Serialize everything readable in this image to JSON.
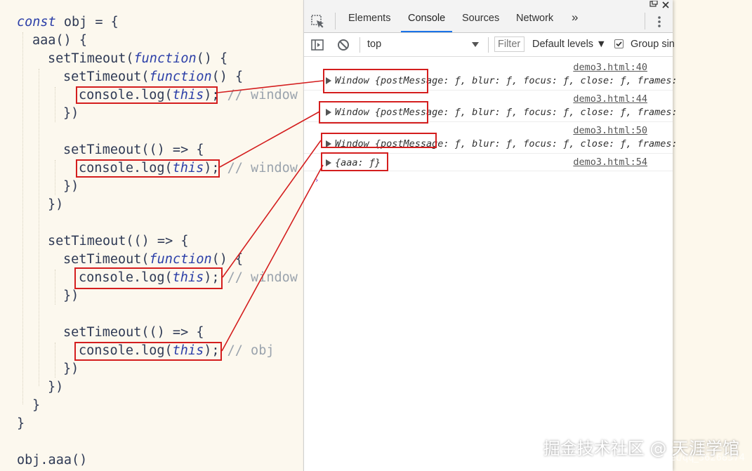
{
  "code": {
    "line1": {
      "kw": "const",
      "rest": " obj = {"
    },
    "line2": "aaa() {",
    "line3": {
      "a": "setTimeout(",
      "kw": "function",
      "b": "() {"
    },
    "line4": {
      "a": "setTimeout(",
      "kw": "function",
      "b": "() {"
    },
    "line5": {
      "a": "console.log(",
      "kw": "this",
      "b": ");",
      "comment": " // window"
    },
    "line6": "})",
    "line7": "setTimeout(() => {",
    "line8": {
      "a": "console.log(",
      "kw": "this",
      "b": ");",
      "comment": " // window"
    },
    "line9": "})",
    "line10": "})",
    "line11": "setTimeout(() => {",
    "line12": {
      "a": "setTimeout(",
      "kw": "function",
      "b": "() {"
    },
    "line13": {
      "a": "console.log(",
      "kw": "this",
      "b": ");",
      "comment": " // window"
    },
    "line14": "})",
    "line15": "setTimeout(() => {",
    "line16": {
      "a": "console.log(",
      "kw": "this",
      "b": ");",
      "comment": " // obj"
    },
    "line17": "})",
    "line18": "})",
    "line19": "}",
    "line20": "}",
    "line21": "obj.aaa()"
  },
  "devtools": {
    "tabs": [
      "Elements",
      "Console",
      "Sources",
      "Network"
    ],
    "more_tabs": "»",
    "active_tab": "Console",
    "context": "top",
    "filter_placeholder": "Filter",
    "levels": "Default levels ▼",
    "group_label": "Group sin",
    "logs": [
      {
        "source": "demo3.html:40",
        "text": "Window {postMessage: ƒ, blur: ƒ, focus: ƒ, close: ƒ, frames:"
      },
      {
        "source": "demo3.html:44",
        "text": "Window {postMessage: ƒ, blur: ƒ, focus: ƒ, close: ƒ, frames:"
      },
      {
        "source": "demo3.html:50",
        "text": "Window {postMessage: ƒ, blur: ƒ, focus: ƒ, close: ƒ, frames:"
      },
      {
        "source": "demo3.html:54",
        "text": "{aaa: ƒ}"
      }
    ]
  },
  "watermark": {
    "text": "掘金技术社区 @ 天涯学馆",
    "url": "https://blog.csdn.net/qq_36268374"
  },
  "colors": {
    "annotation": "#d41e1e",
    "keyword": "#2c3fa8",
    "comment": "#9aa3ad",
    "accent": "#1a73e8"
  }
}
